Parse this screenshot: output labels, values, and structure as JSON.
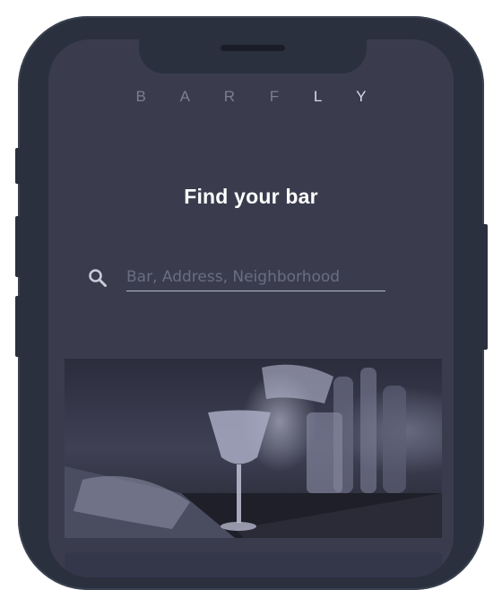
{
  "app": {
    "brand_letters_dim": "B A R F",
    "brand_letters_lit": "L Y"
  },
  "main": {
    "title": "Find your bar"
  },
  "search": {
    "placeholder": "Bar, Address, Neighborhood",
    "value": ""
  },
  "icons": {
    "search": "search-icon"
  },
  "colors": {
    "screen_background": "#3a3c4e",
    "device_frame": "#2a303d",
    "title_text": "#ffffff"
  }
}
